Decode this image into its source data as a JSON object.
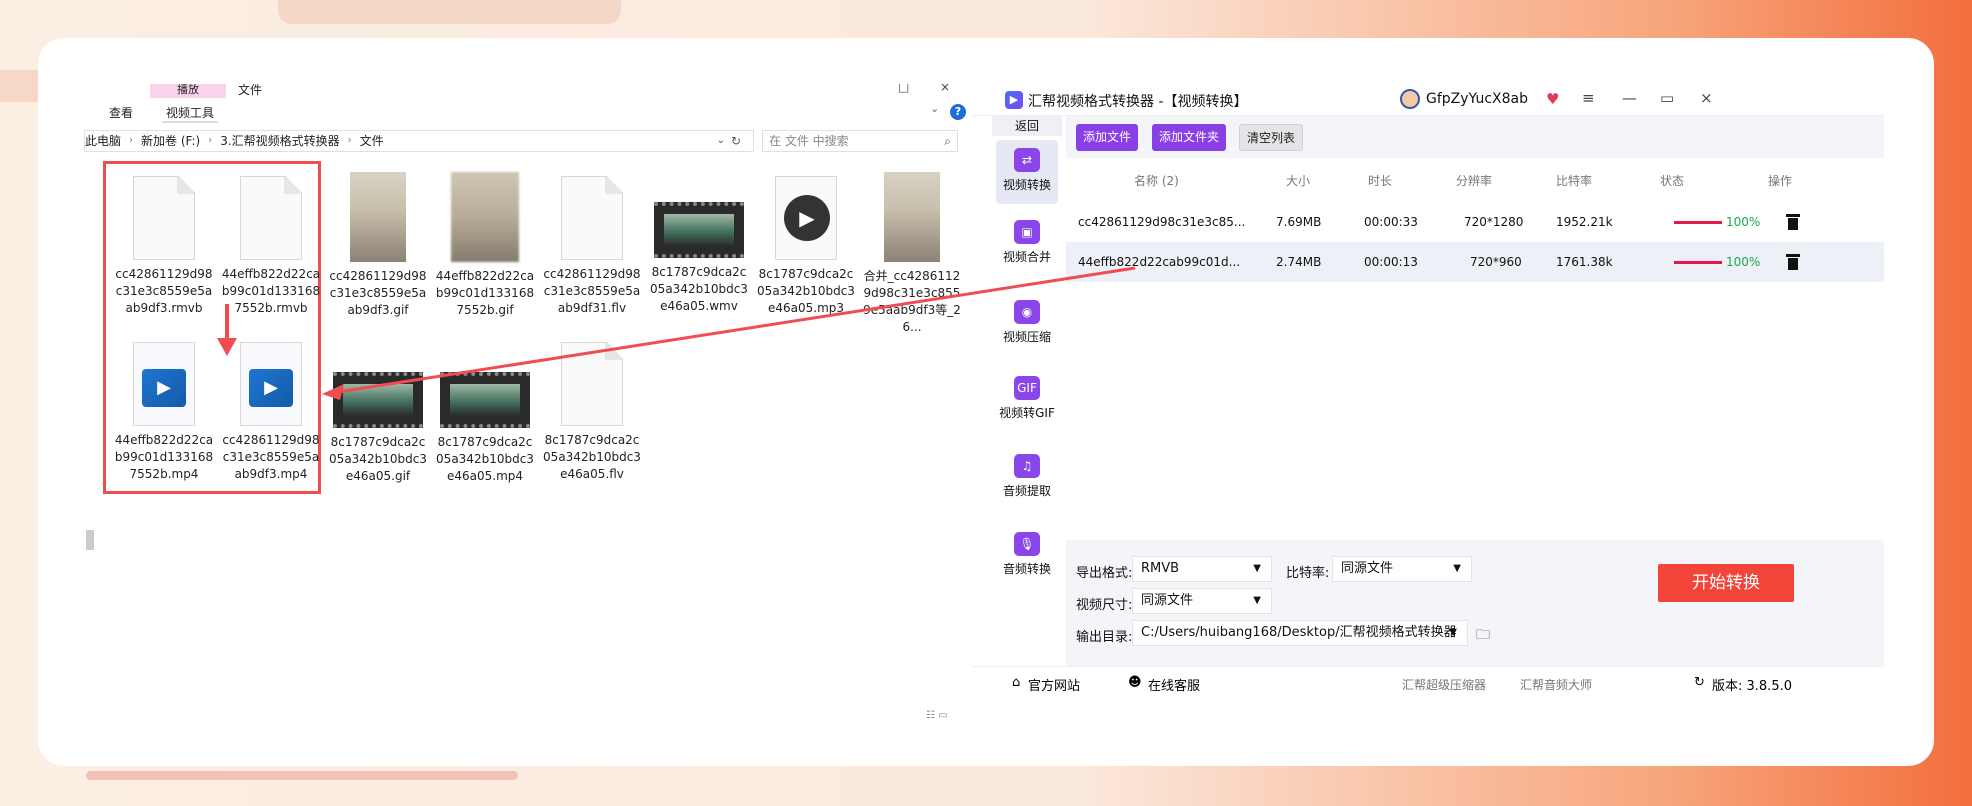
{
  "explorer": {
    "ribbon": {
      "tab_pink": "播放",
      "tab_file": "文件",
      "tab_view": "查看",
      "tab_video_tools": "视频工具",
      "help": "?"
    },
    "breadcrumb": [
      "此电脑",
      "新加卷 (F:)",
      "3.汇帮视频格式转换器",
      "文件"
    ],
    "search_placeholder": "在 文件 中搜索",
    "files": [
      {
        "name": "cc42861129d98c31e3c8559e5aab9df3.rmvb",
        "kind": "doc"
      },
      {
        "name": "44effb822d22cab99c01d1331687552b.rmvb",
        "kind": "doc"
      },
      {
        "name": "cc42861129d98c31e3c8559e5aab9df3.gif",
        "kind": "photo"
      },
      {
        "name": "44effb822d22cab99c01d1331687552b.gif",
        "kind": "photo-blur"
      },
      {
        "name": "cc42861129d98c31e3c8559e5aab9df31.flv",
        "kind": "doc"
      },
      {
        "name": "8c1787c9dca2c05a342b10bdc3e46a05.wmv",
        "kind": "video"
      },
      {
        "name": "8c1787c9dca2c05a342b10bdc3e46a05.mp3",
        "kind": "mp3"
      },
      {
        "name": "合并_cc42861129d98c31e3c8559e5aab9df3等_26...",
        "kind": "photo"
      },
      {
        "name": "44effb822d22cab99c01d1331687552b.mp4",
        "kind": "mp4"
      },
      {
        "name": "cc42861129d98c31e3c8559e5aab9df3.mp4",
        "kind": "mp4"
      },
      {
        "name": "8c1787c9dca2c05a342b10bdc3e46a05.gif",
        "kind": "video"
      },
      {
        "name": "8c1787c9dca2c05a342b10bdc3e46a05.mp4",
        "kind": "video"
      },
      {
        "name": "8c1787c9dca2c05a342b10bdc3e46a05.flv",
        "kind": "doc"
      }
    ]
  },
  "app": {
    "title": "汇帮视频格式转换器 -【视频转换】",
    "user": "GfpZyYucX8ab",
    "sidebar": {
      "back": "返回",
      "items": [
        "视频转换",
        "视频合并",
        "视频压缩",
        "视频转GIF",
        "音频提取",
        "音频转换"
      ]
    },
    "toolbar": {
      "add_file": "添加文件",
      "add_folder": "添加文件夹",
      "clear_list": "清空列表"
    },
    "table": {
      "headers": [
        "名称 (2)",
        "大小",
        "时长",
        "分辨率",
        "比特率",
        "状态",
        "操作"
      ],
      "rows": [
        [
          "cc42861129d98c31e3c85...",
          "7.69MB",
          "00:00:33",
          "720*1280",
          "1952.21k",
          "100%"
        ],
        [
          "44effb822d22cab99c01d...",
          "2.74MB",
          "00:00:13",
          "720*960",
          "1761.38k",
          "100%"
        ]
      ]
    },
    "settings": {
      "format_label": "导出格式:",
      "format_value": "RMVB",
      "bitrate_label": "比特率:",
      "bitrate_value": "同源文件",
      "size_label": "视频尺寸:",
      "size_value": "同源文件",
      "output_label": "输出目录:",
      "output_value": "C:/Users/huibang168/Desktop/汇帮视频格式转换器",
      "start": "开始转换"
    },
    "footer": {
      "website": "官方网站",
      "service": "在线客服",
      "link1": "汇帮超级压缩器",
      "link2": "汇帮音频大师",
      "version": "版本: 3.8.5.0"
    }
  },
  "colors": {
    "accent_purple": "#8a3fe6",
    "start_red": "#f3443a",
    "highlight_red": "#ef4d50",
    "progress": "#e5174b",
    "pct_green": "#18a84c"
  }
}
